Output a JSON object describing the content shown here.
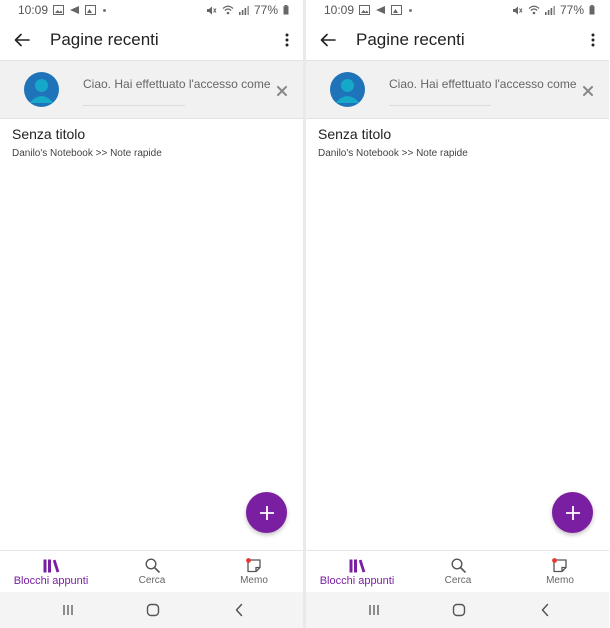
{
  "status": {
    "time": "10:09",
    "battery": "77%"
  },
  "app_bar": {
    "title": "Pagine recenti"
  },
  "banner": {
    "text": "Ciao. Hai effettuato l'accesso come"
  },
  "page_item": {
    "title": "Senza titolo",
    "path": "Danilo's Notebook >> Note rapide"
  },
  "bottom_nav": {
    "items": [
      {
        "label": "Blocchi appunti",
        "icon": "notebooks-icon",
        "active": true
      },
      {
        "label": "Cerca",
        "icon": "search-icon",
        "active": false
      },
      {
        "label": "Memo",
        "icon": "sticky-note-icon",
        "active": false
      }
    ]
  },
  "colors": {
    "accent": "#7b1fa2",
    "avatar": "#1f73b8",
    "avatar_figure": "#16a8c8",
    "banner_bg": "#f1f1f1",
    "memo_dot": "#e53935"
  }
}
